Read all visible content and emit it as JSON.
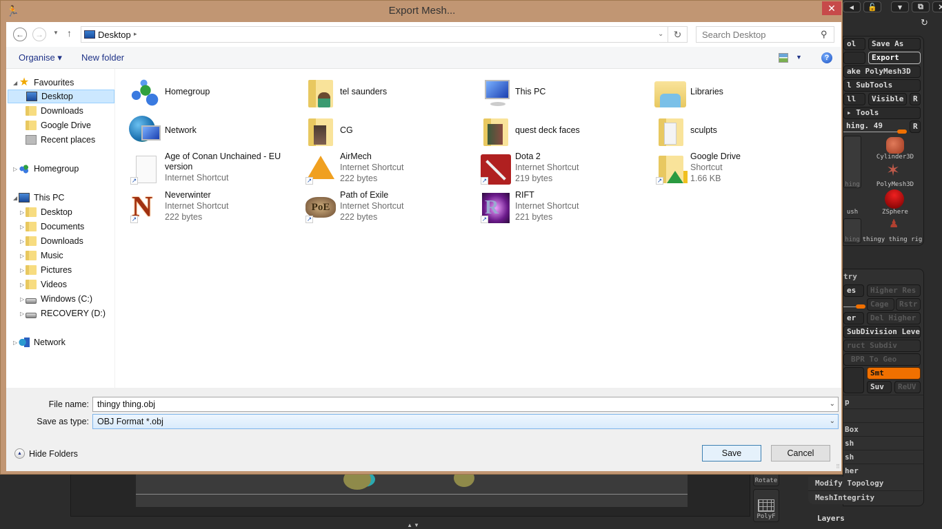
{
  "dialog": {
    "title": "Export Mesh...",
    "close_label": "✕",
    "nav": {
      "back": "←",
      "forward": "→",
      "recent": "▼",
      "up": "↑",
      "address": "Desktop",
      "address_chevron": "▸",
      "refresh": "↻",
      "search_placeholder": "Search Desktop",
      "search_icon": "⚲"
    },
    "toolbar": {
      "organise": "Organise ▾",
      "new_folder": "New folder",
      "view_dropdown": "▼",
      "help": "?"
    },
    "nav_pane": {
      "favourites": {
        "label": "Favourites",
        "items": [
          "Desktop",
          "Downloads",
          "Google Drive",
          "Recent places"
        ]
      },
      "homegroup": "Homegroup",
      "this_pc": {
        "label": "This PC",
        "items": [
          "Desktop",
          "Documents",
          "Downloads",
          "Music",
          "Pictures",
          "Videos",
          "Windows (C:)",
          "RECOVERY (D:)"
        ]
      },
      "network": "Network"
    },
    "files": [
      {
        "name": "Homegroup",
        "icon": "homegroup-icon"
      },
      {
        "name": "tel saunders",
        "icon": "user-folder-icon"
      },
      {
        "name": "This PC",
        "icon": "computer-icon"
      },
      {
        "name": "Libraries",
        "icon": "libraries-icon"
      },
      {
        "name": "Network",
        "icon": "network-icon"
      },
      {
        "name": "CG",
        "icon": "folder-icon"
      },
      {
        "name": "quest deck faces",
        "icon": "folder-icon"
      },
      {
        "name": "sculpts",
        "icon": "folder-icon"
      },
      {
        "name": "Age of Conan Unchained - EU version",
        "type": "Internet Shortcut",
        "size": "",
        "icon": "blank-file-icon"
      },
      {
        "name": "AirMech",
        "type": "Internet Shortcut",
        "size": "222 bytes",
        "icon": "airmech-icon"
      },
      {
        "name": "Dota 2",
        "type": "Internet Shortcut",
        "size": "219 bytes",
        "icon": "dota2-icon"
      },
      {
        "name": "Google Drive",
        "type": "Shortcut",
        "size": "1.66 KB",
        "icon": "google-drive-folder-icon"
      },
      {
        "name": "Neverwinter",
        "type": "Internet Shortcut",
        "size": "222 bytes",
        "icon": "neverwinter-icon"
      },
      {
        "name": "Path of Exile",
        "type": "Internet Shortcut",
        "size": "222 bytes",
        "icon": "path-of-exile-icon"
      },
      {
        "name": "RIFT",
        "type": "Internet Shortcut",
        "size": "221 bytes",
        "icon": "rift-icon"
      }
    ],
    "file_name_label": "File name:",
    "file_name_value": "thingy thing.obj",
    "save_type_label": "Save as type:",
    "save_type_value": "OBJ Format *.obj",
    "hide_folders": "Hide Folders",
    "save": "Save",
    "cancel": "Cancel"
  },
  "zbrush": {
    "top_buttons": [
      "◂",
      "🔓",
      "▾",
      "⧉",
      "✕"
    ],
    "refresh_icon": "↻",
    "tool_panel": {
      "buttons": [
        "ol",
        "Save As",
        "",
        "Export",
        "ake PolyMesh3D",
        "l SubTools",
        "ll",
        "Visible",
        "R",
        "▸ Tools",
        "hing. 49",
        "R"
      ],
      "tools": [
        "Cylinder3D",
        "PolyMesh3D",
        "ZSphere",
        "thingy thing rig"
      ],
      "left_labels": [
        "hing",
        "ush",
        "hing"
      ]
    },
    "geometry_panel": {
      "header": "try",
      "buttons": [
        "es",
        "Higher Res",
        "Cage",
        "Rstr",
        "er",
        "Del Higher",
        "SubDivision Levels",
        "ruct Subdiv",
        "BPR To Geo",
        "Smt",
        "Suv",
        "ReUV"
      ],
      "rows": [
        "p",
        "",
        "Box",
        "sh",
        "sh",
        "her",
        "Modify Topology",
        "MeshIntegrity"
      ]
    },
    "layers": "Layers",
    "side_tools": [
      "Rotate",
      "PolyF"
    ],
    "bottom_arrows": "▲▼"
  }
}
